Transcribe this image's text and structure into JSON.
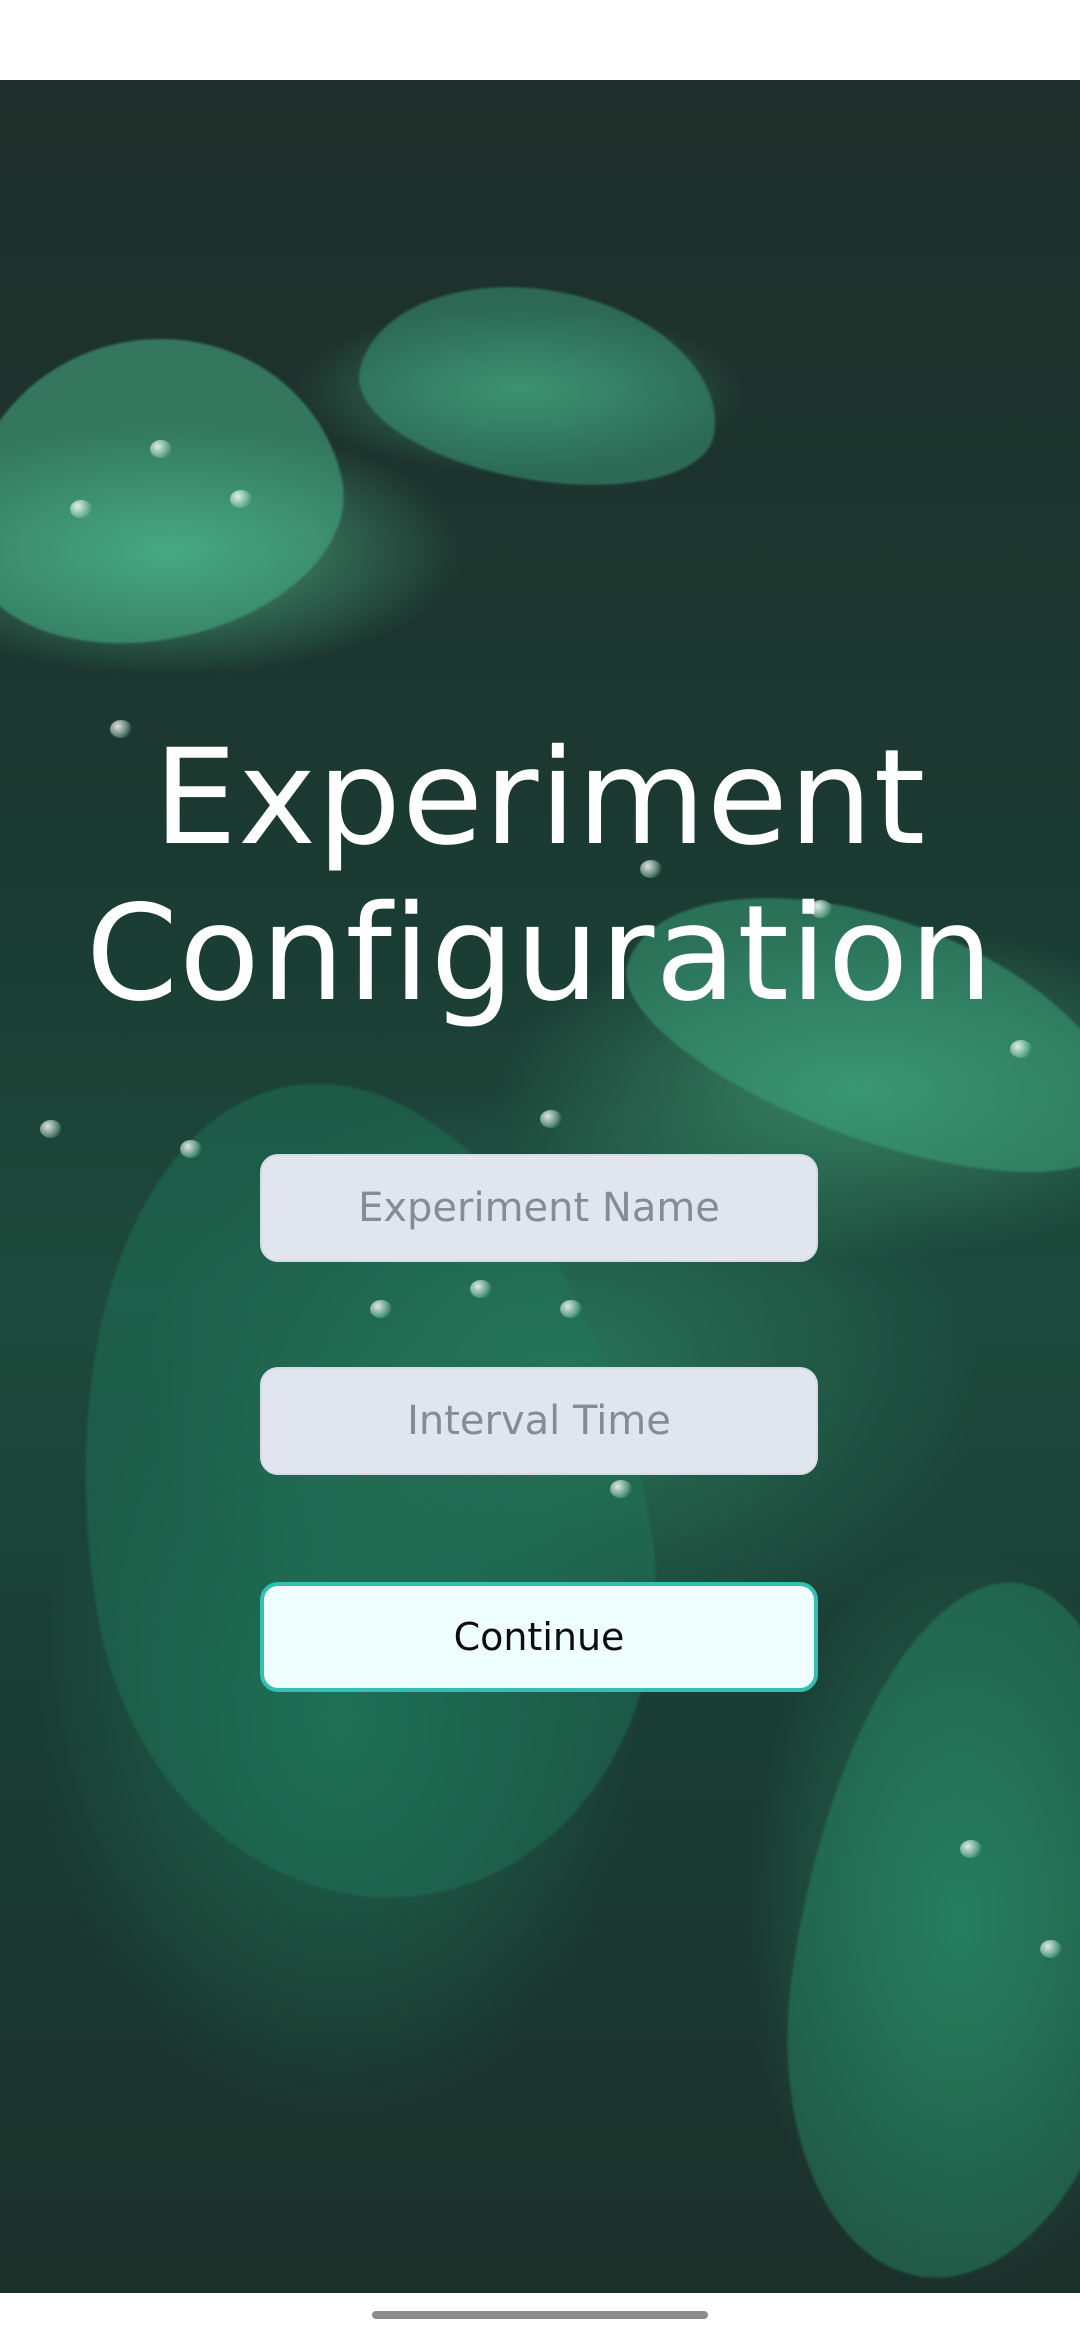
{
  "title": {
    "line1": "Experiment",
    "line2": "Configuration"
  },
  "form": {
    "experiment_name_placeholder": "Experiment Name",
    "interval_time_placeholder": "Interval Time",
    "experiment_name_value": "",
    "interval_time_value": ""
  },
  "continue_label": "Continue",
  "colors": {
    "button_border": "#35bfb1",
    "button_fill": "#effeff",
    "field_fill": "#e1e5ee",
    "title_text": "#ffffff"
  }
}
